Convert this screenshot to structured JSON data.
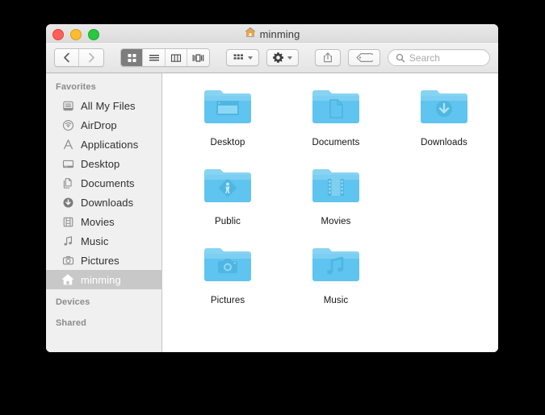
{
  "window": {
    "title": "minming",
    "title_icon": "home-icon",
    "traffic_lights": [
      {
        "name": "close-button",
        "color": "#ff5f57"
      },
      {
        "name": "minimize-button",
        "color": "#febc2e"
      },
      {
        "name": "maximize-button",
        "color": "#28c840"
      }
    ]
  },
  "toolbar": {
    "back_label": "Back",
    "forward_label": "Forward",
    "view_buttons": [
      {
        "name": "icon-view-button",
        "label": "Icon View",
        "selected": true
      },
      {
        "name": "list-view-button",
        "label": "List View",
        "selected": false
      },
      {
        "name": "column-view-button",
        "label": "Column View",
        "selected": false
      },
      {
        "name": "coverflow-view-button",
        "label": "Cover Flow View",
        "selected": false
      }
    ],
    "arrange_label": "Arrange",
    "action_label": "Action",
    "share_label": "Share",
    "tags_label": "Tags"
  },
  "search": {
    "placeholder": "Search",
    "value": ""
  },
  "sidebar": {
    "sections": [
      {
        "header": "Favorites",
        "items": [
          {
            "label": "All My Files",
            "icon": "all-my-files-icon",
            "selected": false
          },
          {
            "label": "AirDrop",
            "icon": "airdrop-icon",
            "selected": false
          },
          {
            "label": "Applications",
            "icon": "applications-icon",
            "selected": false
          },
          {
            "label": "Desktop",
            "icon": "desktop-icon",
            "selected": false
          },
          {
            "label": "Documents",
            "icon": "documents-icon",
            "selected": false
          },
          {
            "label": "Downloads",
            "icon": "downloads-icon",
            "selected": false
          },
          {
            "label": "Movies",
            "icon": "movies-icon",
            "selected": false
          },
          {
            "label": "Music",
            "icon": "music-icon",
            "selected": false
          },
          {
            "label": "Pictures",
            "icon": "pictures-icon",
            "selected": false
          },
          {
            "label": "minming",
            "icon": "home-icon",
            "selected": true
          }
        ]
      },
      {
        "header": "Devices",
        "items": []
      },
      {
        "header": "Shared",
        "items": []
      }
    ]
  },
  "main": {
    "items": [
      {
        "label": "Desktop",
        "icon": "folder-desktop-icon"
      },
      {
        "label": "Documents",
        "icon": "folder-documents-icon"
      },
      {
        "label": "Downloads",
        "icon": "folder-downloads-icon"
      },
      {
        "label": "Public",
        "icon": "folder-public-icon"
      },
      {
        "label": "Movies",
        "icon": "folder-movies-icon"
      },
      {
        "label": "Pictures",
        "icon": "folder-pictures-icon"
      },
      {
        "label": "Music",
        "icon": "folder-music-icon"
      }
    ]
  },
  "colors": {
    "folder_blue": "#6ecaf0",
    "folder_blue_dark": "#4fbce9",
    "selected_row": "#c8c8c8",
    "toolbar_active": "#7d7d7d",
    "desktop_background": "#000000"
  }
}
